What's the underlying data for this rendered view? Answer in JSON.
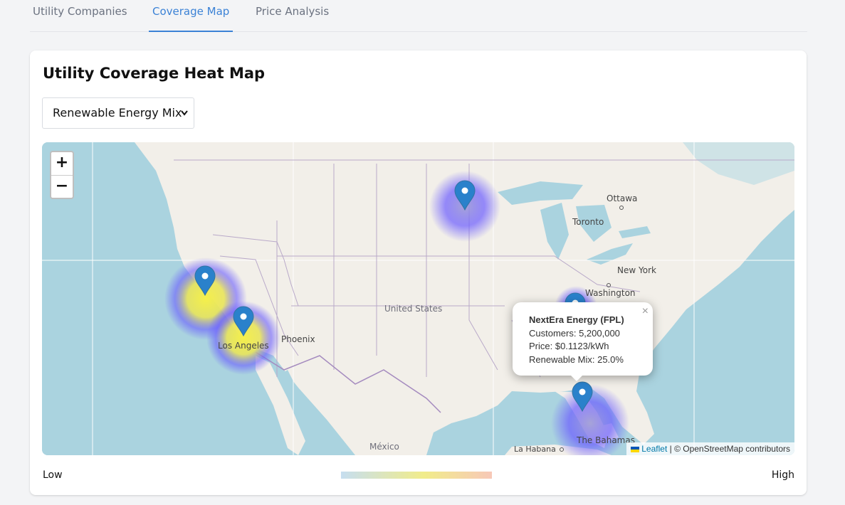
{
  "tabs": [
    {
      "label": "Utility Companies",
      "active": false
    },
    {
      "label": "Coverage Map",
      "active": true
    },
    {
      "label": "Price Analysis",
      "active": false
    }
  ],
  "card": {
    "title": "Utility Coverage Heat Map",
    "select": {
      "selected": "Renewable Energy Mix",
      "caret_icon": "chevron-down-icon"
    }
  },
  "map": {
    "zoom_in": "+",
    "zoom_out": "−",
    "labels": {
      "ottawa": "Ottawa",
      "toronto": "Toronto",
      "new_york": "New York",
      "washington": "Washington",
      "united_states": "United States",
      "phoenix": "Phoenix",
      "los_angeles": "Los Angeles",
      "mexico": "México",
      "la_habana": "La Habana",
      "bahamas": "The Bahamas"
    },
    "popup": {
      "title": "NextEra Energy (FPL)",
      "customers": "Customers: 5,200,000",
      "price": "Price: $0.1123/kWh",
      "renewable": "Renewable Mix: 25.0%",
      "close": "×"
    },
    "attribution": {
      "leaflet": "Leaflet",
      "rest": " | © OpenStreetMap contributors"
    },
    "colors": {
      "water": "#aad3df",
      "land": "#f2efe9",
      "marker": "#2a81cb"
    }
  },
  "legend": {
    "low": "Low",
    "high": "High",
    "gradient": [
      "#c6def0",
      "#f1ec8a",
      "#f7c8b8"
    ]
  }
}
